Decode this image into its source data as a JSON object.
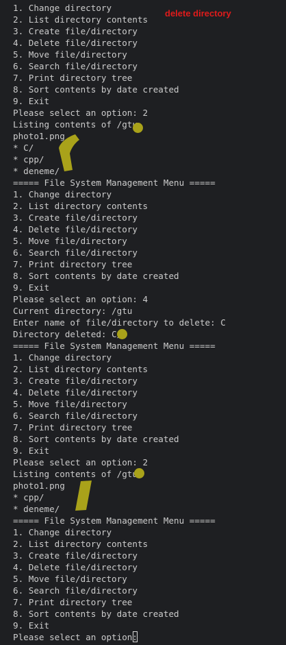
{
  "terminal": {
    "lines": [
      "1. Change directory",
      "2. List directory contents",
      "3. Create file/directory",
      "4. Delete file/directory",
      "5. Move file/directory",
      "6. Search file/directory",
      "7. Print directory tree",
      "8. Sort contents by date created",
      "9. Exit",
      "Please select an option: 2",
      "Listing contents of /gtu",
      "photo1.png",
      "* C/",
      "* cpp/",
      "* deneme/",
      "===== File System Management Menu =====",
      "1. Change directory",
      "2. List directory contents",
      "3. Create file/directory",
      "4. Delete file/directory",
      "5. Move file/directory",
      "6. Search file/directory",
      "7. Print directory tree",
      "8. Sort contents by date created",
      "9. Exit",
      "Please select an option: 4",
      "Current directory: /gtu",
      "Enter name of file/directory to delete: C",
      "Directory deleted: C/",
      "===== File System Management Menu =====",
      "1. Change directory",
      "2. List directory contents",
      "3. Create file/directory",
      "4. Delete file/directory",
      "5. Move file/directory",
      "6. Search file/directory",
      "7. Print directory tree",
      "8. Sort contents by date created",
      "9. Exit",
      "Please select an option: 2",
      "Listing contents of /gtu",
      "photo1.png",
      "* cpp/",
      "* deneme/",
      "===== File System Management Menu =====",
      "1. Change directory",
      "2. List directory contents",
      "3. Create file/directory",
      "4. Delete file/directory",
      "5. Move file/directory",
      "6. Search file/directory",
      "7. Print directory tree",
      "8. Sort contents by date created",
      "9. Exit",
      "Please select an option: "
    ]
  },
  "annotations": {
    "note": "delete directory",
    "note_color": "#e01b1b",
    "highlight_color": "#a9a21a"
  },
  "colors": {
    "background": "#1e1f22",
    "text": "#cccccc"
  }
}
